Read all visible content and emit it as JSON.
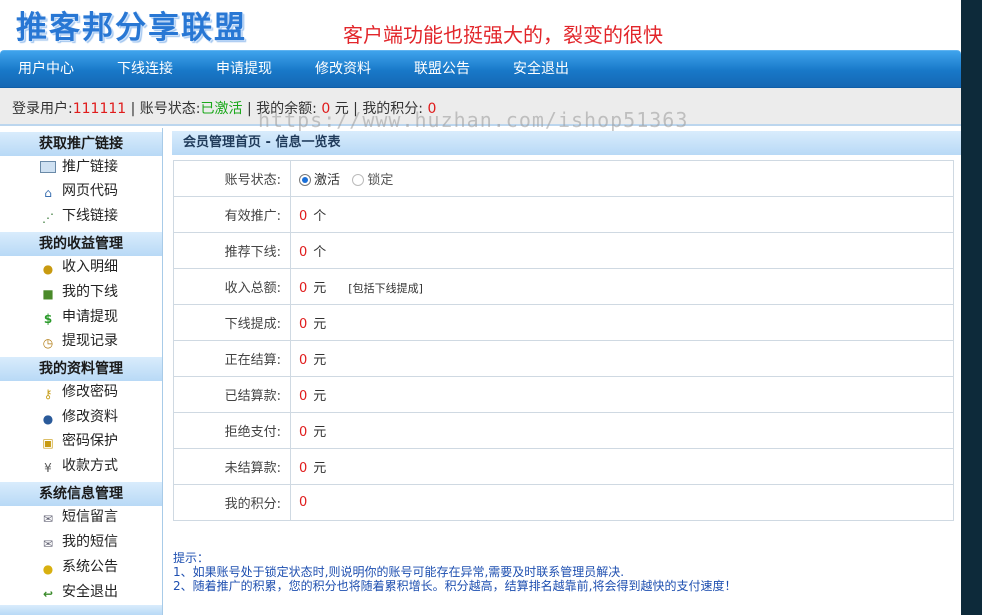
{
  "header": {
    "logo": "推客邦分享联盟",
    "slogan": "客户端功能也挺强大的，裂变的很快"
  },
  "nav": {
    "items": [
      "用户中心",
      "下线连接",
      "申请提现",
      "修改资料",
      "联盟公告",
      "安全退出"
    ]
  },
  "userbar": {
    "login_label": "登录用户:",
    "login_user": "111111",
    "sep": " | ",
    "status_label": "账号状态:",
    "status_value": "已激活",
    "balance_label": "我的余额:",
    "balance_value": "0",
    "balance_unit": "元",
    "points_label": "我的积分:",
    "points_value": "0"
  },
  "watermark": "https://www.huzhan.com/ishop51363",
  "sidebar": {
    "sections": [
      {
        "title": "获取推广链接",
        "items": [
          {
            "label": "推广链接",
            "icon": "computer-icon"
          },
          {
            "label": "网页代码",
            "icon": "home-icon"
          },
          {
            "label": "下线链接",
            "icon": "network-icon"
          }
        ]
      },
      {
        "title": "我的收益管理",
        "items": [
          {
            "label": "收入明细",
            "icon": "coins-icon"
          },
          {
            "label": "我的下线",
            "icon": "box-icon"
          },
          {
            "label": "申请提现",
            "icon": "dollar-icon"
          },
          {
            "label": "提现记录",
            "icon": "clock-icon"
          }
        ]
      },
      {
        "title": "我的资料管理",
        "items": [
          {
            "label": "修改密码",
            "icon": "key-icon"
          },
          {
            "label": "修改资料",
            "icon": "users-icon"
          },
          {
            "label": "密码保护",
            "icon": "lock-icon"
          },
          {
            "label": "收款方式",
            "icon": "yen-icon"
          }
        ]
      },
      {
        "title": "系统信息管理",
        "items": [
          {
            "label": "短信留言",
            "icon": "envelope-icon"
          },
          {
            "label": "我的短信",
            "icon": "envelope-icon"
          },
          {
            "label": "系统公告",
            "icon": "lightbulb-icon"
          },
          {
            "label": "安全退出",
            "icon": "exit-icon"
          }
        ]
      }
    ]
  },
  "main": {
    "title": "会员管理首页 - 信息一览表",
    "account_status": {
      "label": "账号状态:",
      "options": [
        "激活",
        "锁定"
      ],
      "selected": "激活"
    },
    "rows": [
      {
        "label": "有效推广:",
        "value": "0",
        "unit": "个"
      },
      {
        "label": "推荐下线:",
        "value": "0",
        "unit": "个"
      },
      {
        "label": "收入总额:",
        "value": "0",
        "unit": "元",
        "note": "[包括下线提成]"
      },
      {
        "label": "下线提成:",
        "value": "0",
        "unit": "元"
      },
      {
        "label": "正在结算:",
        "value": "0",
        "unit": "元"
      },
      {
        "label": "已结算款:",
        "value": "0",
        "unit": "元"
      },
      {
        "label": "拒绝支付:",
        "value": "0",
        "unit": "元"
      },
      {
        "label": "未结算款:",
        "value": "0",
        "unit": "元"
      },
      {
        "label": "我的积分:",
        "value": "0",
        "unit": ""
      }
    ]
  },
  "tips": {
    "title": "提示：",
    "lines": [
      "1、如果账号处于锁定状态时,则说明你的账号可能存在异常,需要及时联系管理员解决.",
      "2、随着推广的积累，您的积分也将随着累积增长。积分越高，结算排名越靠前,将会得到越快的支付速度！"
    ]
  },
  "colors": {
    "nav_blue": "#1878c8",
    "logo_blue": "#2877d4",
    "slogan_red": "#e2262b",
    "value_red": "#e01b1b",
    "status_green": "#1aa81a",
    "tips_blue": "#1e4fb0"
  }
}
